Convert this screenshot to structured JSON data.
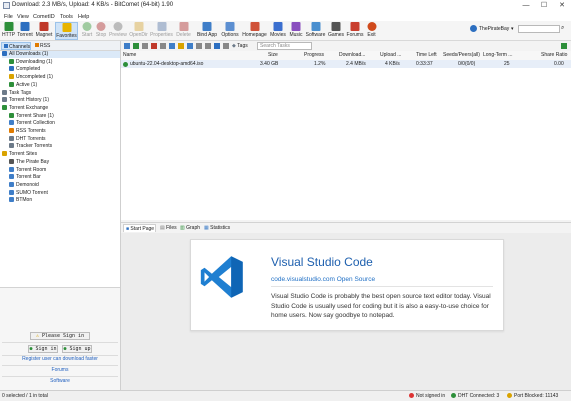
{
  "window": {
    "title": "Download: 2.3 MB/s, Upload: 4 KB/s - BitComet (64-bit) 1.90",
    "minimize": "—",
    "maximize": "☐",
    "close": "✕"
  },
  "menu": [
    "File",
    "View",
    "CometID",
    "Tools",
    "Help"
  ],
  "toolbar": [
    {
      "label": "HTTP",
      "color": "#2d8f3a"
    },
    {
      "label": "Torrent",
      "color": "#2d6fc0"
    },
    {
      "label": "Magnet",
      "color": "#c0392b"
    },
    {
      "label": "Favorites",
      "color": "#e8b400"
    },
    {
      "label": "Start",
      "color": "#3a9a3a"
    },
    {
      "label": "Stop",
      "color": "#b03030"
    },
    {
      "label": "Preview",
      "color": "#777777"
    },
    {
      "label": "OpenDir",
      "color": "#d7a83b"
    },
    {
      "label": "Properties",
      "color": "#5a79a8"
    },
    {
      "label": "Delete",
      "color": "#b03030"
    },
    {
      "label": "Bind App",
      "color": "#3f7ec8"
    },
    {
      "label": "Options",
      "color": "#5c8fd1"
    },
    {
      "label": "Homepage",
      "color": "#d0533a"
    },
    {
      "label": "Movies",
      "color": "#3b6fcf"
    },
    {
      "label": "Music",
      "color": "#8a4fbf"
    },
    {
      "label": "Software",
      "color": "#4a8fcf"
    },
    {
      "label": "Games",
      "color": "#555555"
    },
    {
      "label": "Forums",
      "color": "#c93f2f"
    },
    {
      "label": "Exit",
      "color": "#d04a1c"
    }
  ],
  "search": {
    "engine": "ThePirateBay",
    "placeholder": "Search Tasks",
    "tags_label": "Tags"
  },
  "left_tabs": {
    "channels": "Channels",
    "rss": "RSS"
  },
  "tree": [
    {
      "label": "All Downloads (1)",
      "level": 0,
      "color": "#2d6fc0",
      "selected": true
    },
    {
      "label": "Downloading (1)",
      "level": 1,
      "color": "#2d8f3a"
    },
    {
      "label": "Completed",
      "level": 1,
      "color": "#2d6fc0"
    },
    {
      "label": "Uncompleted (1)",
      "level": 1,
      "color": "#d9a300"
    },
    {
      "label": "Active (1)",
      "level": 1,
      "color": "#2d8f3a"
    },
    {
      "label": "Task Tags",
      "level": 0,
      "color": "#6c7a89"
    },
    {
      "label": "Torrent History (1)",
      "level": 0,
      "color": "#6c7a89"
    },
    {
      "label": "Torrent Exchange",
      "level": 0,
      "color": "#2d8f3a"
    },
    {
      "label": "Torrent Share (1)",
      "level": 1,
      "color": "#2d8f3a"
    },
    {
      "label": "Torrent Collection",
      "level": 1,
      "color": "#3f7ec8"
    },
    {
      "label": "RSS Torrents",
      "level": 1,
      "color": "#e07b00"
    },
    {
      "label": "DHT Torrents",
      "level": 1,
      "color": "#6c7a89"
    },
    {
      "label": "Tracker Torrents",
      "level": 1,
      "color": "#6c7a89"
    },
    {
      "label": "Torrent Sites",
      "level": 0,
      "color": "#d9a300"
    },
    {
      "label": "The Pirate Bay",
      "level": 1,
      "color": "#555555"
    },
    {
      "label": "Torrent Room",
      "level": 1,
      "color": "#3f7ec8"
    },
    {
      "label": "Torrent Bar",
      "level": 1,
      "color": "#3f7ec8"
    },
    {
      "label": "Demonoid",
      "level": 1,
      "color": "#3f7ec8"
    },
    {
      "label": "SUMO Torrent",
      "level": 1,
      "color": "#3f7ec8"
    },
    {
      "label": "BTMon",
      "level": 1,
      "color": "#3f7ec8"
    }
  ],
  "account": {
    "banner": "Please Sign in",
    "signin": "Sign in",
    "signup": "Sign up",
    "register": "Register user can download faster",
    "forums": "Forums",
    "software": "Software"
  },
  "columns": [
    "Name",
    "Size",
    "Progress",
    "Download...",
    "Upload ...",
    "Time Left",
    "Seeds/Peers(all)",
    "Long-Term ...",
    "Share Ratio"
  ],
  "tasks": [
    {
      "name": "ubuntu-22.04-desktop-amd64.iso",
      "size": "3.40 GB",
      "progress": "1.2%",
      "download": "2.4 MB/s",
      "upload": "4 KB/s",
      "time_left": "0:33:37",
      "seeds": "0/0(0/0)",
      "longterm": "25",
      "ratio": "0.00"
    }
  ],
  "bottom_tabs": [
    "Start Page",
    "Files",
    "Graph",
    "Statistics"
  ],
  "promo": {
    "title": "Visual Studio Code",
    "link": "code.visualstudio.com Open Source",
    "body": "Visual Studio Code is probably the best open source text editor today. Visual Studio Code is usually used for coding but it is also a easy-to-use choice for home users. Now say goodbye to notepad.",
    "logo_color": "#1f7fd1"
  },
  "status": {
    "selection": "0 selected / 1 in total",
    "signed": "Not signed in",
    "dht": "DHT Connected: 3",
    "port": "Port Blocked: 11143"
  }
}
